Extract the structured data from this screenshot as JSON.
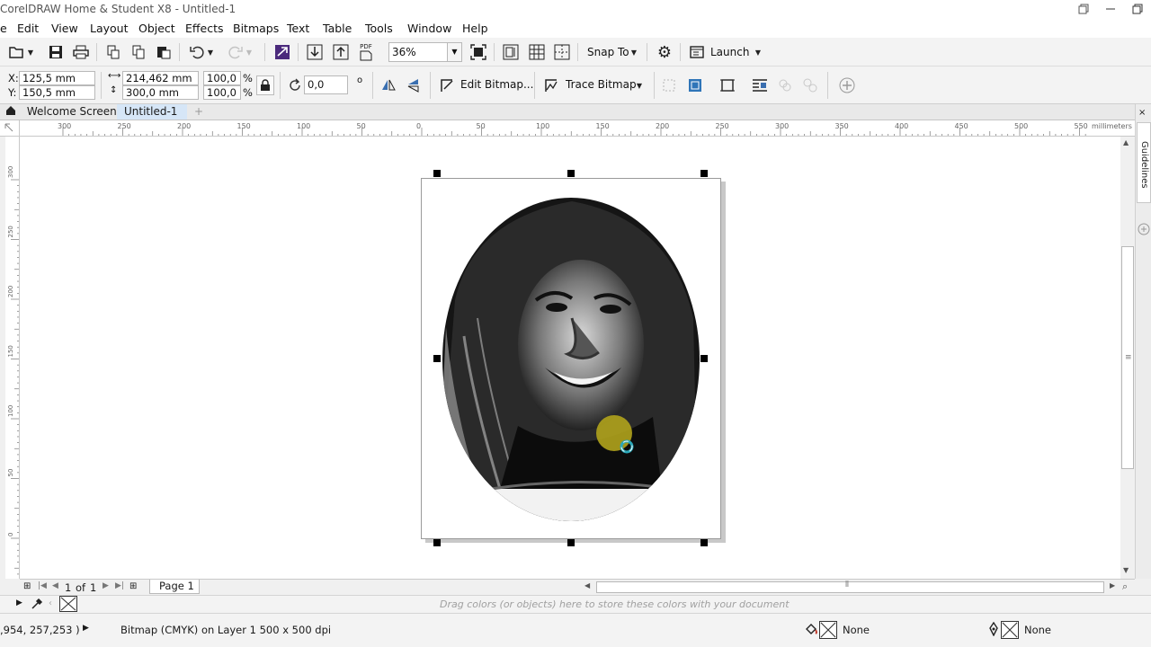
{
  "window": {
    "title": "CorelDRAW Home & Student X8 - Untitled-1"
  },
  "menu": [
    "Edit",
    "View",
    "Layout",
    "Object",
    "Effects",
    "Bitmaps",
    "Text",
    "Table",
    "Tools",
    "Window",
    "Help"
  ],
  "toolbar": {
    "zoom_value": "36%",
    "snap_label": "Snap To",
    "launch_label": "Launch",
    "pdf_label": "PDF"
  },
  "properties": {
    "x_label": "X:",
    "x_value": "125,5 mm",
    "y_label": "Y:",
    "y_value": "150,5 mm",
    "width_value": "214,462 mm",
    "height_value": "300,0 mm",
    "scale_x": "100,0",
    "scale_y": "100,0",
    "percent": "%",
    "rotation_value": "0,0",
    "degree": "o",
    "edit_bitmap_label": "Edit Bitmap...",
    "trace_bitmap_label": "Trace Bitmap"
  },
  "tabs": [
    {
      "label": "Welcome Screen"
    },
    {
      "label": "Untitled-1"
    }
  ],
  "ruler": {
    "top_ticks": [
      "300",
      "250",
      "200",
      "150",
      "100",
      "50",
      "0",
      "50",
      "100",
      "150",
      "200",
      "250",
      "300",
      "350",
      "400",
      "450",
      "500",
      "550"
    ],
    "unit": "millimeters",
    "left_ticks": [
      "300",
      "250",
      "200",
      "150",
      "100",
      "50",
      "0"
    ]
  },
  "dock": {
    "guidelines_label": "Guidelines"
  },
  "page_nav": {
    "current": "1",
    "of_label": "of",
    "total": "1",
    "page_tab": "Page 1"
  },
  "palette": {
    "hint": "Drag colors (or objects) here to store these colors with your document"
  },
  "status": {
    "coordinates": ",954, 257,253 )",
    "selection_info": "Bitmap (CMYK) on Layer 1 500 x 500 dpi",
    "fill_label": "None",
    "outline_label": "None"
  },
  "colors": {
    "tab_active_bg": "#d6e6f7",
    "cursor_highlight": "#b0a31c",
    "selection_handle": "#000000"
  }
}
